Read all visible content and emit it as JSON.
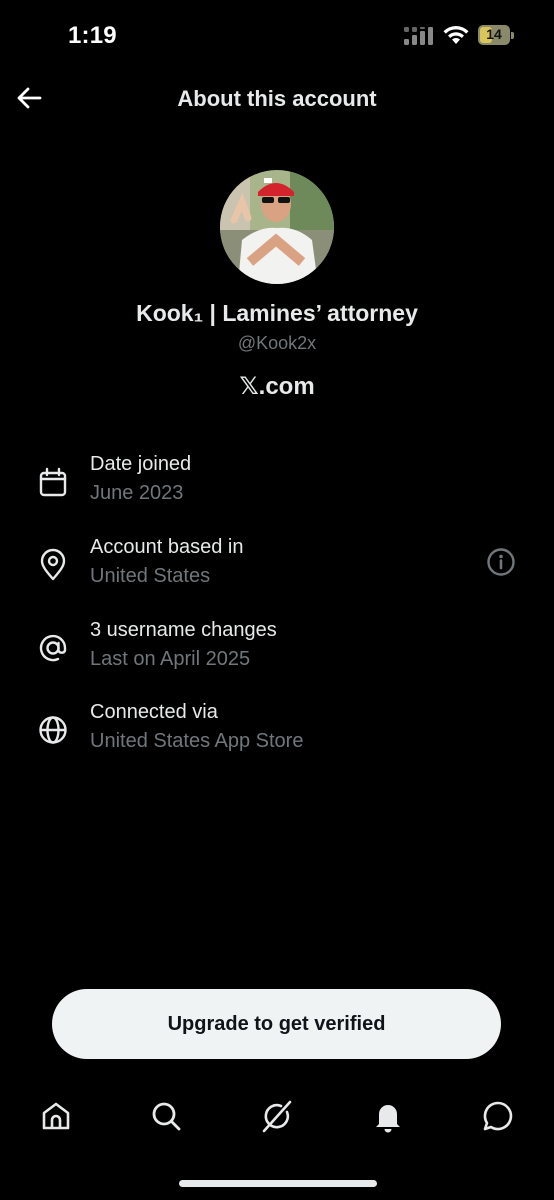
{
  "status_bar": {
    "time": "1:19",
    "battery": "14"
  },
  "header": {
    "title": "About this account"
  },
  "profile": {
    "display_name": "Kook₁ | Lamines’ attorney",
    "handle": "@Kook2x",
    "domain": "𝕏.com"
  },
  "info_rows": [
    {
      "label": "Date joined",
      "value": "June 2023",
      "icon": "calendar-icon"
    },
    {
      "label": "Account based in",
      "value": "United States",
      "icon": "location-pin-icon"
    },
    {
      "label": "3 username changes",
      "value": "Last on April 2025",
      "icon": "at-sign-icon"
    },
    {
      "label": "Connected via",
      "value": "United States App Store",
      "icon": "globe-icon"
    }
  ],
  "cta": {
    "label": "Upgrade to get verified"
  },
  "tabbar": [
    "home-icon",
    "search-icon",
    "grok-icon",
    "notifications-icon",
    "messages-icon"
  ],
  "colors": {
    "background": "#000000",
    "text": "#e7e9ea",
    "muted": "#71767b",
    "button_bg": "#eff3f4"
  }
}
